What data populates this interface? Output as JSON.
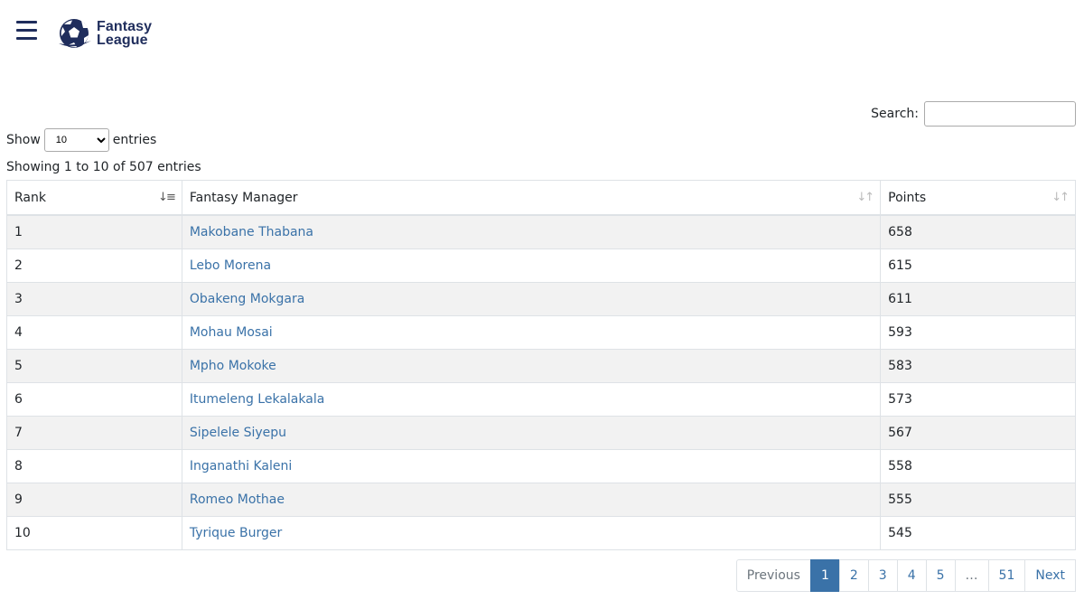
{
  "brand": {
    "line1": "Fantasy",
    "line2": "League",
    "color": "#1f2d5c"
  },
  "search": {
    "label": "Search:",
    "value": "",
    "placeholder": ""
  },
  "length": {
    "show_label": "Show",
    "selected": "10",
    "entries_label": "entries"
  },
  "info": "Showing 1 to 10 of 507 entries",
  "table": {
    "columns": [
      "Rank",
      "Fantasy Manager",
      "Points"
    ],
    "rows": [
      {
        "rank": "1",
        "manager": "Makobane Thabana",
        "points": "658"
      },
      {
        "rank": "2",
        "manager": "Lebo Morena",
        "points": "615"
      },
      {
        "rank": "3",
        "manager": "Obakeng Mokgara",
        "points": "611"
      },
      {
        "rank": "4",
        "manager": "Mohau Mosai",
        "points": "593"
      },
      {
        "rank": "5",
        "manager": "Mpho Mokoke",
        "points": "583"
      },
      {
        "rank": "6",
        "manager": "Itumeleng Lekalakala",
        "points": "573"
      },
      {
        "rank": "7",
        "manager": "Sipelele Siyepu",
        "points": "567"
      },
      {
        "rank": "8",
        "manager": "Inganathi Kaleni",
        "points": "558"
      },
      {
        "rank": "9",
        "manager": "Romeo Mothae",
        "points": "555"
      },
      {
        "rank": "10",
        "manager": "Tyrique Burger",
        "points": "545"
      }
    ]
  },
  "pagination": {
    "previous": "Previous",
    "pages": [
      "1",
      "2",
      "3",
      "4",
      "5"
    ],
    "ellipsis": "…",
    "last": "51",
    "next": "Next",
    "current": "1"
  },
  "colors": {
    "link": "#3a72a8",
    "active_page": "#3a72a8",
    "stripe": "#f2f2f2"
  }
}
